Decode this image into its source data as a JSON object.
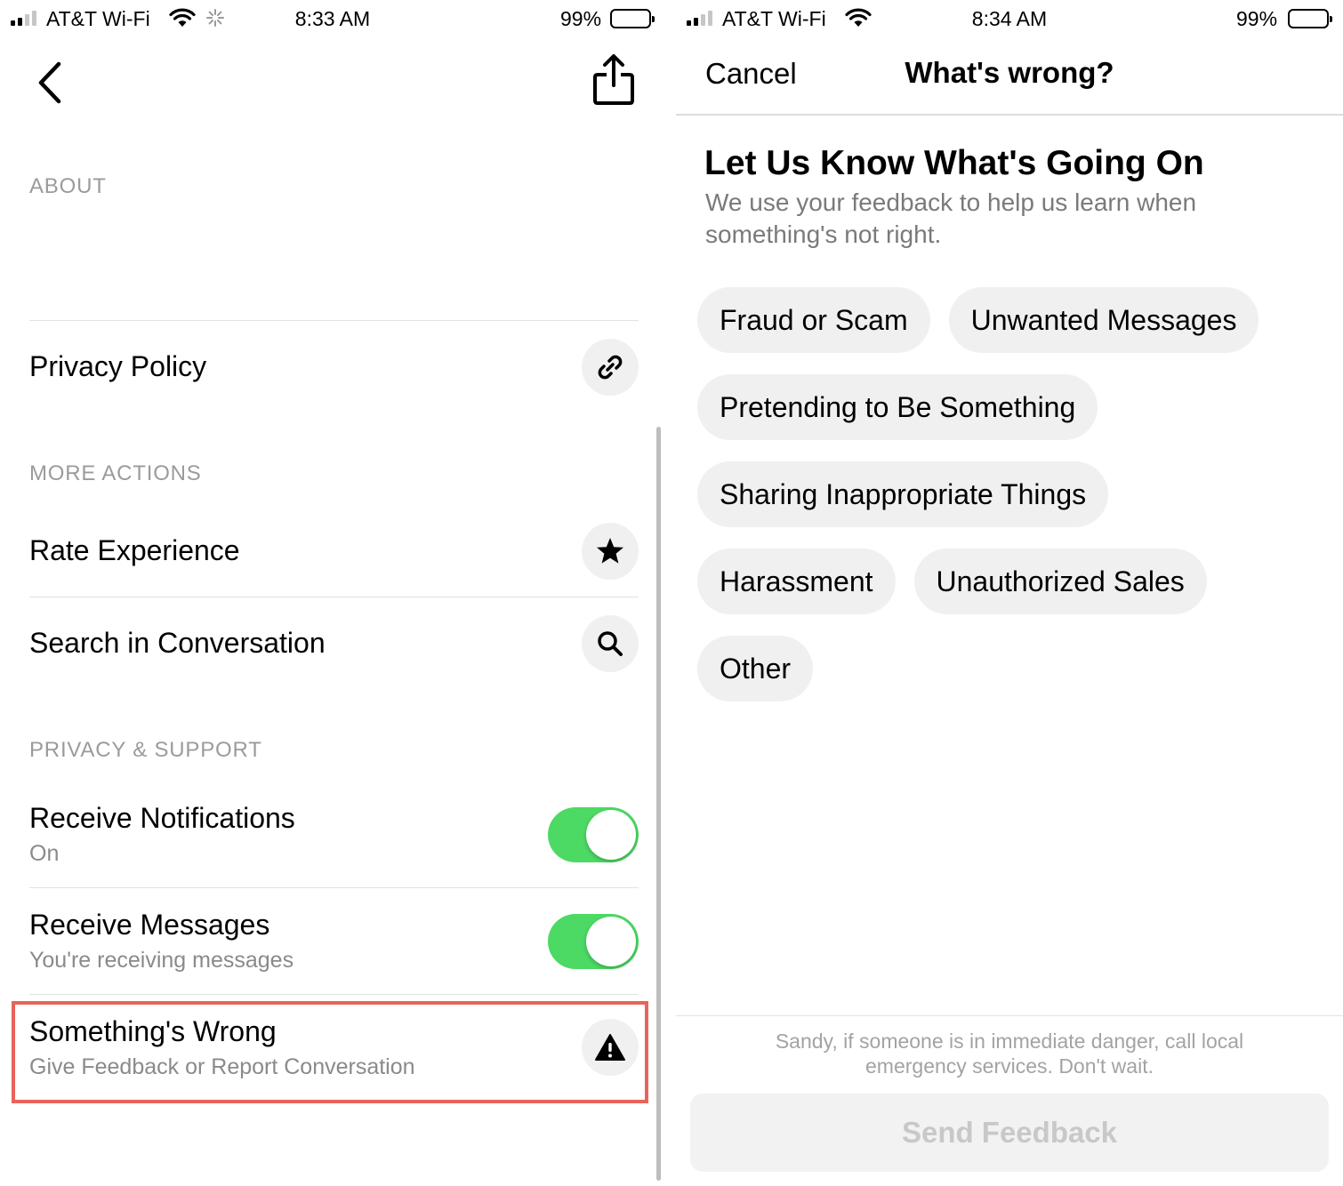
{
  "left_screen": {
    "status_bar": {
      "carrier": "AT&T Wi-Fi",
      "time": "8:33 AM",
      "battery_percent": "99%"
    },
    "nav": {
      "back_icon": "chevron-left-icon",
      "share_icon": "share-icon"
    },
    "about": {
      "label": "ABOUT"
    },
    "privacy_policy": {
      "label": "Privacy Policy",
      "icon": "link-icon"
    },
    "more_actions": {
      "label": "MORE ACTIONS",
      "items": [
        {
          "label": "Rate Experience",
          "icon": "star-icon"
        },
        {
          "label": "Search in Conversation",
          "icon": "search-icon"
        }
      ]
    },
    "privacy_support": {
      "label": "PRIVACY & SUPPORT",
      "notifications": {
        "title": "Receive Notifications",
        "subtitle": "On",
        "enabled": true
      },
      "messages": {
        "title": "Receive Messages",
        "subtitle": "You're receiving messages",
        "enabled": true
      },
      "something_wrong": {
        "title": "Something's Wrong",
        "subtitle": "Give Feedback or Report Conversation",
        "icon": "warning-icon"
      }
    },
    "colors": {
      "toggle_on": "#4cd964",
      "highlight": "#e8645a"
    }
  },
  "right_screen": {
    "status_bar": {
      "carrier": "AT&T Wi-Fi",
      "time": "8:34 AM",
      "battery_percent": "99%"
    },
    "nav": {
      "cancel_label": "Cancel",
      "title": "What's wrong?"
    },
    "heading": "Let Us Know What's Going On",
    "description": "We use your feedback to help us learn when something's not right.",
    "options": [
      [
        "Fraud or Scam",
        "Unwanted Messages"
      ],
      [
        "Pretending to Be Something"
      ],
      [
        "Sharing Inappropriate Things"
      ],
      [
        "Harassment",
        "Unauthorized Sales"
      ],
      [
        "Other"
      ]
    ],
    "footer_note": "Sandy, if someone is in immediate danger, call local emergency services. Don't wait.",
    "send_button_label": "Send Feedback"
  }
}
